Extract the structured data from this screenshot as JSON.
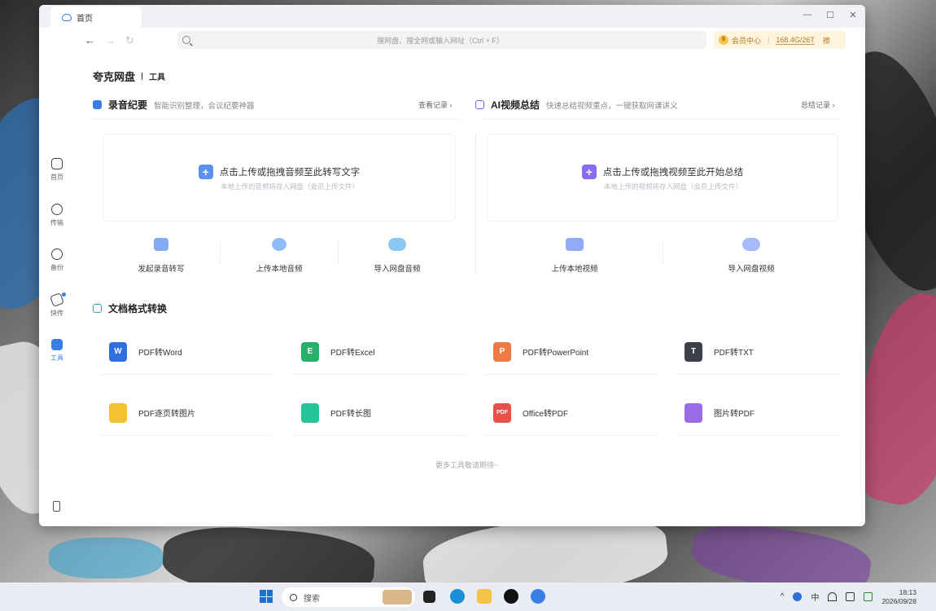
{
  "window": {
    "tab_label": "首页",
    "controls": {
      "minimize": "—",
      "maximize": "☐",
      "close": "✕"
    }
  },
  "navbar": {
    "back": "←",
    "forward": "→",
    "refresh": "↻",
    "search_placeholder": "搜网盘、搜全网或输入网址（Ctrl + F）",
    "vip": {
      "coin": "$",
      "label": "会员中心",
      "storage": "168.4G/26T",
      "extra": "擦"
    }
  },
  "sidebar": {
    "items": [
      {
        "label": "首页",
        "icon": "home-icon"
      },
      {
        "label": "传输",
        "icon": "transfer-icon"
      },
      {
        "label": "备份",
        "icon": "backup-icon"
      },
      {
        "label": "快传",
        "icon": "quick-send-icon"
      },
      {
        "label": "工具",
        "icon": "tools-icon",
        "active": true
      }
    ],
    "bottom_icon": "phone-icon"
  },
  "page": {
    "title": "夸克网盘",
    "subtitle": "工具"
  },
  "recording": {
    "title": "录音纪要",
    "desc": "智能识别整理，会议纪要神器",
    "link": "查看记录 ›",
    "accent": "#3b7de6",
    "drop_main": "点击上传或拖拽音频至此转写文字",
    "drop_sub": "本地上传的音频将存入网盘（会员上传文件）",
    "actions": [
      {
        "label": "发起录音转写",
        "icon": "record-file-icon",
        "color": "#5b8ff0"
      },
      {
        "label": "上传本地音频",
        "icon": "audio-disc-icon",
        "color": "#6aa5f5"
      },
      {
        "label": "导入网盘音频",
        "icon": "cloud-audio-icon",
        "color": "#63b5f0"
      }
    ]
  },
  "ai_video": {
    "title": "AI视频总结",
    "desc": "快速总结视频重点，一键获取网课讲义",
    "link": "总结记录 ›",
    "accent": "#7b5cf0",
    "drop_main": "点击上传或拖拽视频至此开始总结",
    "drop_sub": "本地上传的视频将存入网盘（会员上传文件）",
    "actions": [
      {
        "label": "上传本地视频",
        "icon": "video-camera-icon",
        "color": "#6d8ef5"
      },
      {
        "label": "导入网盘视频",
        "icon": "cloud-video-icon",
        "color": "#8aa2f5"
      }
    ]
  },
  "convert": {
    "title": "文档格式转换",
    "items": [
      {
        "label": "PDF转Word",
        "glyph": "W",
        "color": "#2f6fe0",
        "icon": "word-icon"
      },
      {
        "label": "PDF转Excel",
        "glyph": "E",
        "color": "#27b06b",
        "icon": "excel-icon"
      },
      {
        "label": "PDF转PowerPoint",
        "glyph": "P",
        "color": "#ef7a45",
        "icon": "powerpoint-icon"
      },
      {
        "label": "PDF转TXT",
        "glyph": "T",
        "color": "#3a3f4a",
        "icon": "txt-icon"
      },
      {
        "label": "PDF逐页转图片",
        "glyph": "",
        "color": "#f2c230",
        "icon": "images-icon"
      },
      {
        "label": "PDF转长图",
        "glyph": "",
        "color": "#25c49a",
        "icon": "long-image-icon"
      },
      {
        "label": "Office转PDF",
        "glyph": "PDF",
        "color": "#e8504a",
        "icon": "pdf-icon"
      },
      {
        "label": "图片转PDF",
        "glyph": "",
        "color": "#9a6ce8",
        "icon": "picture-pdf-icon"
      }
    ],
    "more": "更多工具敬请期待~"
  },
  "taskbar": {
    "search_label": "搜索",
    "tray_ime": "中",
    "time": "18:13",
    "date": "2026/09/28"
  }
}
